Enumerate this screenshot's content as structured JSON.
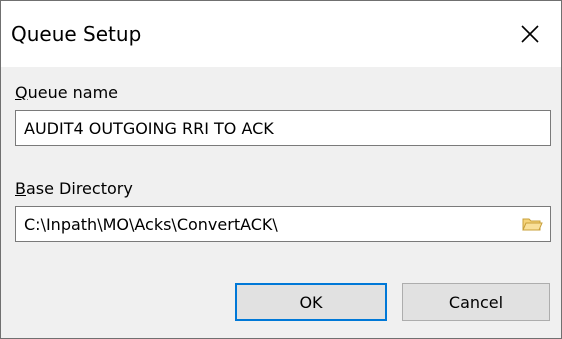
{
  "window": {
    "title": "Queue Setup"
  },
  "queue_name": {
    "label_accel": "Q",
    "label_rest": "ueue name",
    "value": "AUDIT4 OUTGOING RRI TO ACK"
  },
  "base_directory": {
    "label_accel": "B",
    "label_rest": "ase Directory",
    "value": "C:\\Inpath\\MO\\Acks\\ConvertACK\\"
  },
  "buttons": {
    "ok_label": "OK",
    "cancel_label": "Cancel"
  },
  "icons": {
    "close": "close-icon",
    "browse": "folder-icon"
  },
  "colors": {
    "focus_border": "#0078d7",
    "folder_fill": "#f5d37a",
    "folder_stroke": "#c9a03a"
  }
}
